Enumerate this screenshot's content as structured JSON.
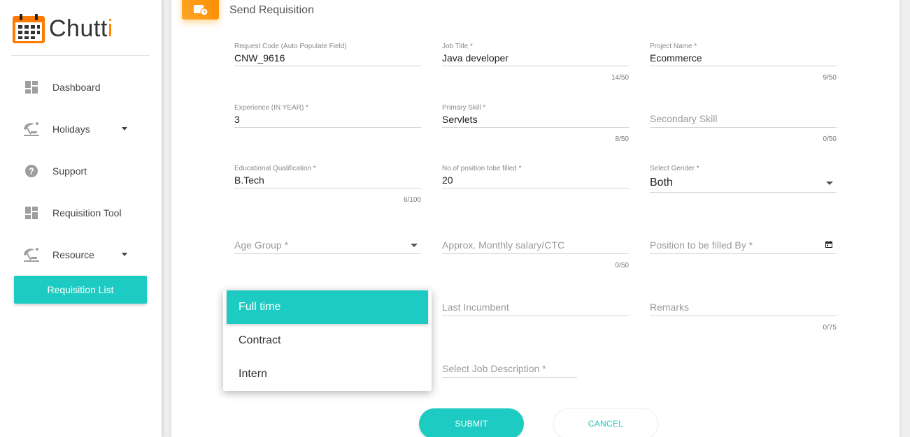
{
  "brand": {
    "name_main": "Chutt",
    "name_accent": "i",
    "accent_color": "#ff8a00"
  },
  "sidebar": {
    "items": [
      {
        "label": "Dashboard",
        "icon": "dashboard-icon"
      },
      {
        "label": "Holidays",
        "icon": "beach-umbrella-icon",
        "has_caret": true
      },
      {
        "label": "Support",
        "icon": "help-circle-icon"
      },
      {
        "label": "Requisition Tool",
        "icon": "dashboard-icon"
      },
      {
        "label": "Resource",
        "icon": "beach-umbrella-icon",
        "has_caret": true
      },
      {
        "label": "Requisition List",
        "active": true
      }
    ]
  },
  "form": {
    "title": "Send Requisition",
    "request_code": {
      "label": "Request Code (Auto Populate Field)",
      "value": "CNW_9616"
    },
    "job_title": {
      "label": "Job Title *",
      "value": "Java developer",
      "counter": "14/50"
    },
    "project_name": {
      "label": "Project Name *",
      "value": "Ecommerce",
      "counter": "9/50"
    },
    "experience": {
      "label": "Experience (IN YEAR) *",
      "value": "3"
    },
    "primary_skill": {
      "label": "Primary Skill *",
      "value": "Servlets",
      "counter": "8/50"
    },
    "secondary_skill": {
      "placeholder": "Secondary Skill",
      "counter": "0/50"
    },
    "education": {
      "label": "Educational Qualification *",
      "value": "B.Tech",
      "counter": "6/100"
    },
    "positions": {
      "label": "No.of position tobe filled *",
      "value": "20"
    },
    "gender": {
      "label": "Select Gender *",
      "value": "Both"
    },
    "age_group": {
      "placeholder": "Age Group *"
    },
    "salary": {
      "placeholder": "Approx. Monthly salary/CTC",
      "counter": "0/50"
    },
    "filled_by": {
      "placeholder": "Position to be filled By *"
    },
    "last_incumbent": {
      "placeholder": "Last Incumbent"
    },
    "remarks": {
      "placeholder": "Remarks",
      "counter": "0/75"
    },
    "job_description": {
      "placeholder": "Select Job Description *"
    }
  },
  "employment_menu": {
    "options": [
      "Full time",
      "Contract",
      "Intern"
    ],
    "selected": "Full time"
  },
  "buttons": {
    "submit": "SUBMIT",
    "cancel": "CANCEL"
  },
  "colors": {
    "teal": "#1ecbc2",
    "orange": "#fb8c00"
  }
}
